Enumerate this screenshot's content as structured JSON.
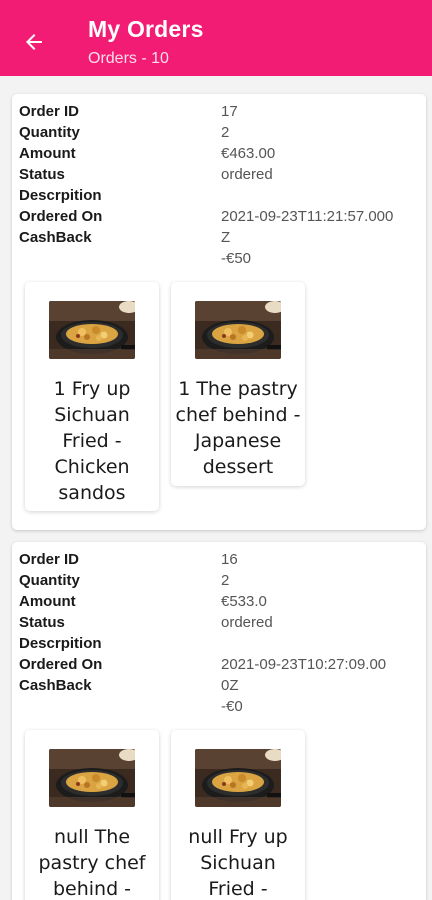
{
  "header": {
    "title": "My Orders",
    "subtitle": "Orders - 10",
    "back_icon": "arrow-left-icon"
  },
  "colors": {
    "appbar": "#f31c74",
    "card": "#ffffff",
    "background": "#f3f3f3"
  },
  "labels": {
    "order_id": "Order ID",
    "quantity": "Quantity",
    "amount": "Amount",
    "status": "Status",
    "description": "Descrpition",
    "ordered_on": "Ordered On",
    "cashback": "CashBack"
  },
  "orders": [
    {
      "order_id": "17",
      "quantity": "2",
      "amount": "€463.00",
      "status": "ordered",
      "description": "",
      "ordered_on": "2021-09-23T11:21:57.000",
      "ordered_on_suffix": "Z",
      "cashback": "-€50",
      "items": [
        {
          "name": "1 Fry up Sichuan Fried - Chicken sandos",
          "image": "food-image-icon"
        },
        {
          "name": "1 The pastry chef behind - Japanese dessert",
          "image": "food-image-icon"
        }
      ]
    },
    {
      "order_id": "16",
      "quantity": "2",
      "amount": "€533.0",
      "status": "ordered",
      "description": "",
      "ordered_on": "2021-09-23T10:27:09.00",
      "ordered_on_suffix": "0Z",
      "cashback": "-€0",
      "items": [
        {
          "name": "null The pastry chef behind -",
          "image": "food-image-icon"
        },
        {
          "name": "null Fry up Sichuan Fried -",
          "image": "food-image-icon"
        }
      ]
    }
  ]
}
